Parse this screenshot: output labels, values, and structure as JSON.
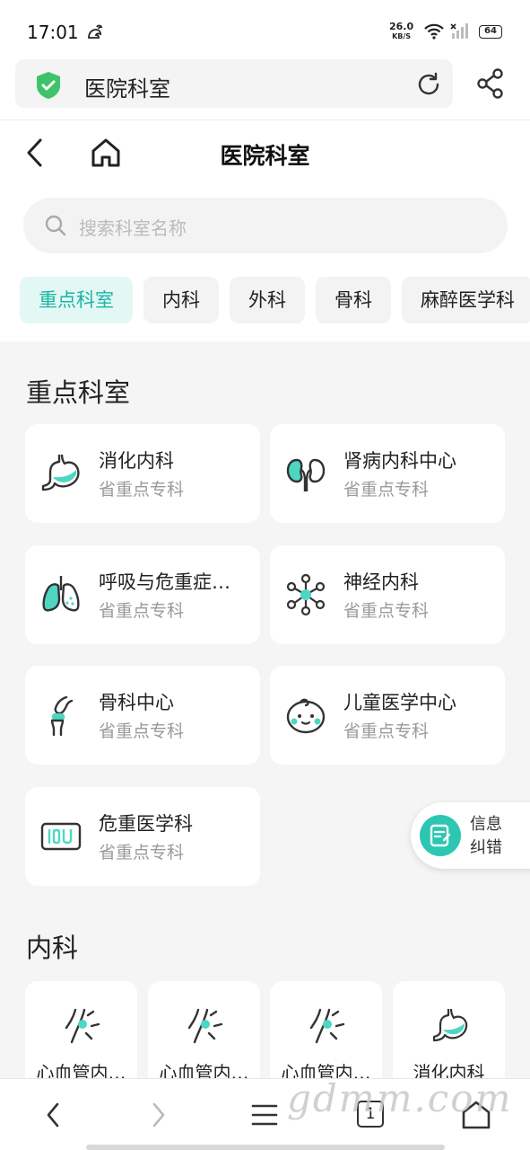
{
  "status": {
    "time": "17:01",
    "net_speed": "26.0",
    "net_unit": "KB/S",
    "battery": "64"
  },
  "browser": {
    "url_title": "医院科室"
  },
  "header": {
    "title": "医院科室"
  },
  "search": {
    "placeholder": "搜索科室名称"
  },
  "tabs": [
    {
      "label": "重点科室",
      "active": true
    },
    {
      "label": "内科"
    },
    {
      "label": "外科"
    },
    {
      "label": "骨科"
    },
    {
      "label": "麻醉医学科"
    }
  ],
  "key_section": {
    "title": "重点科室",
    "items": [
      {
        "name": "消化内科",
        "sub": "省重点专科",
        "icon": "stomach-icon"
      },
      {
        "name": "肾病内科中心",
        "sub": "省重点专科",
        "icon": "kidney-icon"
      },
      {
        "name": "呼吸与危重症…",
        "sub": "省重点专科",
        "icon": "lungs-icon"
      },
      {
        "name": "神经内科",
        "sub": "省重点专科",
        "icon": "neuron-icon"
      },
      {
        "name": "骨科中心",
        "sub": "省重点专科",
        "icon": "bone-joint-icon"
      },
      {
        "name": "儿童医学中心",
        "sub": "省重点专科",
        "icon": "baby-face-icon"
      },
      {
        "name": "危重医学科",
        "sub": "省重点专科",
        "icon": "icu-icon"
      }
    ]
  },
  "float": {
    "label": "信息纠错"
  },
  "internal_section": {
    "title": "内科",
    "items": [
      {
        "name": "心血管内…",
        "icon": "blood-vessel-icon"
      },
      {
        "name": "心血管内…",
        "icon": "blood-vessel-icon"
      },
      {
        "name": "心血管内…",
        "icon": "blood-vessel-icon"
      },
      {
        "name": "消化内科",
        "icon": "stomach-icon"
      }
    ]
  },
  "bottombar": {
    "tab_count": "1"
  },
  "watermark": "gdmm.com",
  "colors": {
    "accent": "#2cc6b2",
    "accent_text": "#19b5a3",
    "tab_active_bg": "#e3f7f5"
  }
}
